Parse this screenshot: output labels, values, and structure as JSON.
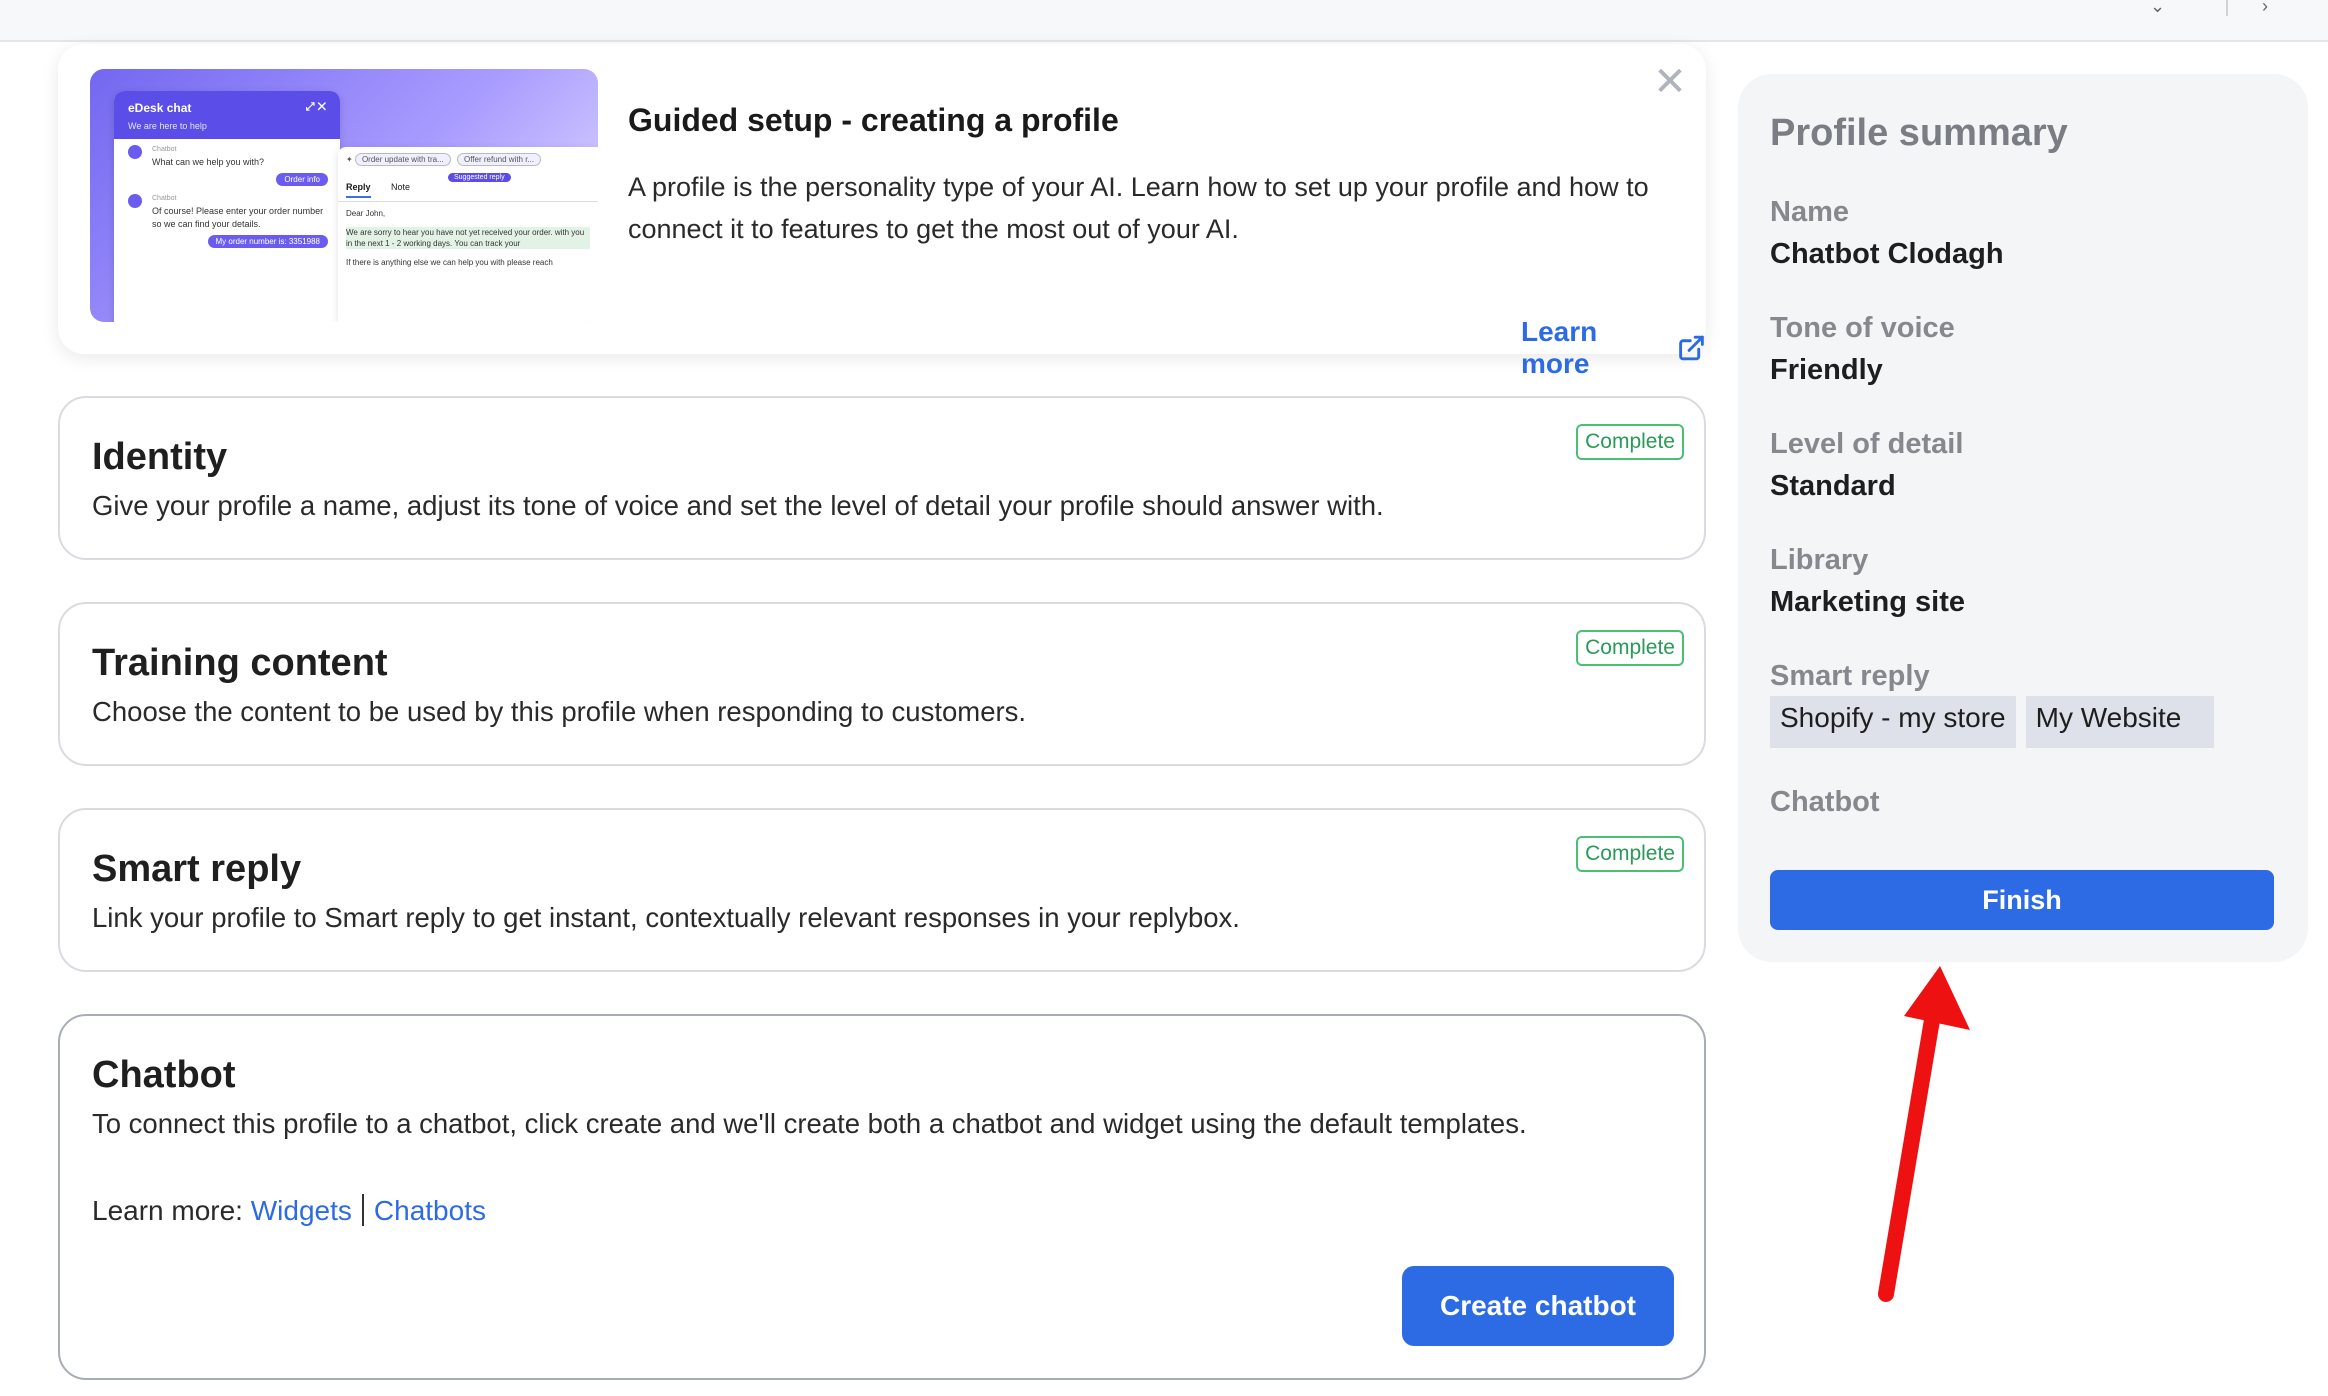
{
  "guide": {
    "title": "Guided setup - creating a profile",
    "description": "A profile is the personality type of your AI. Learn how to set up your profile and how to connect it to features to get the most out of your AI.",
    "learn_more": "Learn more",
    "close_glyph": "✕",
    "preview": {
      "chat_title": "eDesk chat",
      "chat_subtitle": "We are here to help",
      "bot_name": "Chatbot",
      "bot_msg_1": "What can we help you with?",
      "user_pill_1": "Order info",
      "bot_msg_2": "Of course! Please enter your order number so we can find your details.",
      "user_pill_2": "My order number is: 3351988",
      "chip_1": "Order update with tra...",
      "chip_2": "Offer refund with r...",
      "suggested": "Suggested reply",
      "tab_reply": "Reply",
      "tab_note": "Note",
      "greeting": "Dear John,",
      "highlight": "We are sorry to hear you have not yet received your order. with you in the next 1 - 2 working days. You can track your",
      "closing": "If there is anything else we can help you with please reach"
    }
  },
  "steps": [
    {
      "title": "Identity",
      "description": "Give your profile a name, adjust its tone of voice and set the level of detail your profile should answer with.",
      "status": "Complete"
    },
    {
      "title": "Training content",
      "description": "Choose the content to be used by this profile when responding to customers.",
      "status": "Complete"
    },
    {
      "title": "Smart reply",
      "description": "Link your profile to Smart reply to get instant, contextually relevant responses in your replybox.",
      "status": "Complete"
    },
    {
      "title": "Chatbot",
      "description": "To connect this profile to a chatbot, click create and we'll create both a chatbot and widget using the default templates.",
      "learn_prefix": "Learn more:",
      "link_widgets": "Widgets",
      "link_chatbots": "Chatbots",
      "button": "Create chatbot"
    }
  ],
  "summary": {
    "title": "Profile summary",
    "name_label": "Name",
    "name_value": "Chatbot Clodagh",
    "tone_label": "Tone of voice",
    "tone_value": "Friendly",
    "detail_label": "Level of detail",
    "detail_value": "Standard",
    "library_label": "Library",
    "library_value": "Marketing site",
    "smart_reply_label": "Smart reply",
    "smart_reply_tags": [
      "Shopify - my store",
      "My Website"
    ],
    "chatbot_label": "Chatbot",
    "finish": "Finish"
  },
  "colors": {
    "primary": "#2d6be4",
    "complete": "#2a9a58",
    "annotation_arrow": "#ee1111"
  }
}
